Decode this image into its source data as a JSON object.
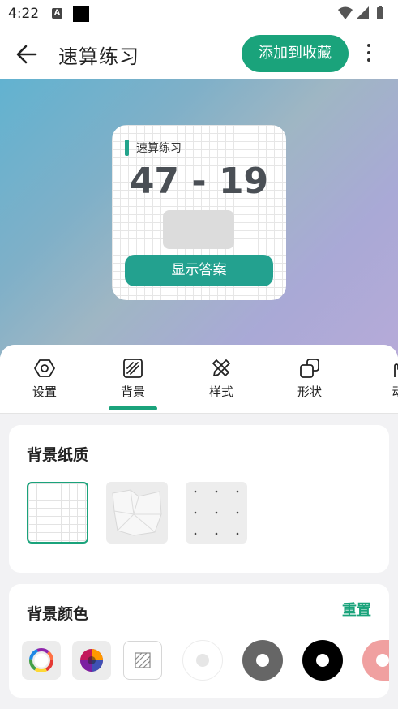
{
  "status_bar": {
    "time": "4:22",
    "notification_letter": "A"
  },
  "app_bar": {
    "title": "速算练习",
    "favorite_button": "添加到收藏"
  },
  "widget": {
    "title": "速算练习",
    "expression": "47 - 19",
    "answer_button": "显示答案",
    "accent_color": "#23a48c"
  },
  "tabs": [
    {
      "label": "设置",
      "icon": "hexagon-settings-icon"
    },
    {
      "label": "背景",
      "icon": "hatched-square-icon",
      "active": true
    },
    {
      "label": "样式",
      "icon": "pencil-ruler-icon"
    },
    {
      "label": "形状",
      "icon": "shapes-icon"
    },
    {
      "label": "动",
      "icon": "hand-icon"
    }
  ],
  "texture_card": {
    "title": "背景纸质",
    "options": [
      "grid",
      "crumpled-paper",
      "dots"
    ],
    "selected": "grid"
  },
  "color_card": {
    "title": "背景颜色",
    "reset_label": "重置",
    "swatches": [
      "color-wheel",
      "color-palette",
      "transparent",
      "white",
      "gray",
      "black",
      "pink"
    ]
  },
  "colors": {
    "brand": "#1aa37b",
    "widget_button": "#23a18f"
  }
}
